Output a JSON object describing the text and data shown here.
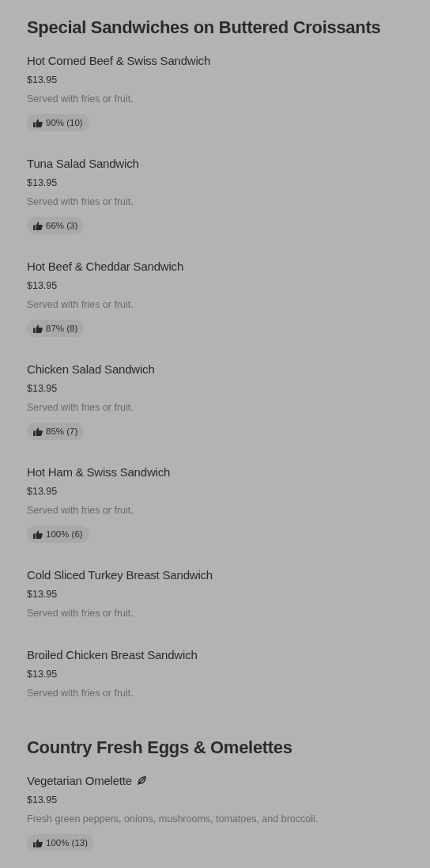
{
  "sections": [
    {
      "title": "Special Sandwiches on Buttered Croissants",
      "items": [
        {
          "name": "Hot Corned Beef & Swiss Sandwich",
          "vegetarian": false,
          "price": "$13.95",
          "description": "Served with fries or fruit.",
          "rating": "90% (10)"
        },
        {
          "name": "Tuna Salad Sandwich",
          "vegetarian": false,
          "price": "$13.95",
          "description": "Served with fries or fruit.",
          "rating": "66% (3)"
        },
        {
          "name": "Hot Beef & Cheddar Sandwich",
          "vegetarian": false,
          "price": "$13.95",
          "description": "Served with fries or fruit.",
          "rating": "87% (8)"
        },
        {
          "name": "Chicken Salad Sandwich",
          "vegetarian": false,
          "price": "$13.95",
          "description": "Served with fries or fruit.",
          "rating": "85% (7)"
        },
        {
          "name": "Hot Ham & Swiss Sandwich",
          "vegetarian": false,
          "price": "$13.95",
          "description": "Served with fries or fruit.",
          "rating": "100% (6)"
        },
        {
          "name": "Cold Sliced Turkey Breast Sandwich",
          "vegetarian": false,
          "price": "$13.95",
          "description": "Served with fries or fruit."
        },
        {
          "name": "Broiled Chicken Breast Sandwich",
          "vegetarian": false,
          "price": "$13.95",
          "description": "Served with fries or fruit."
        }
      ]
    },
    {
      "title": "Country Fresh Eggs & Omelettes",
      "items": [
        {
          "name": "Vegetarian Omelette",
          "vegetarian": true,
          "price": "$13.95",
          "description": "Fresh green peppers, onions, mushrooms, tomatoes, and broccoli.",
          "rating": "100% (13)"
        }
      ]
    }
  ]
}
